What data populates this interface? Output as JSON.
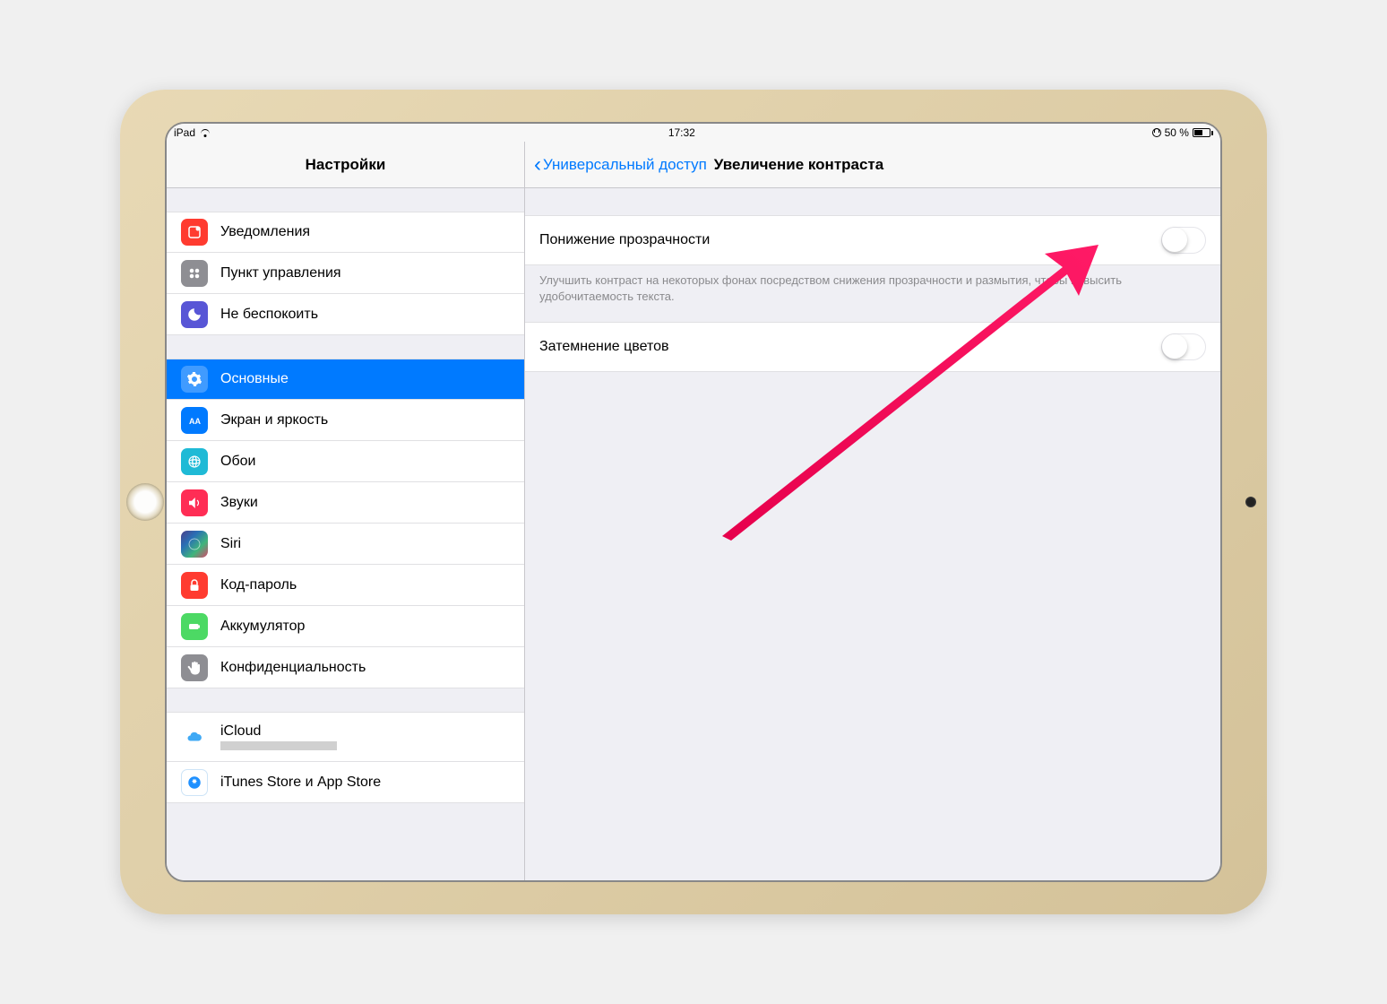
{
  "statusbar": {
    "device": "iPad",
    "time": "17:32",
    "battery_pct": "50 %"
  },
  "sidebar": {
    "title": "Настройки",
    "group1": [
      {
        "label": "Уведомления"
      },
      {
        "label": "Пункт управления"
      },
      {
        "label": "Не беспокоить"
      }
    ],
    "group2": [
      {
        "label": "Основные"
      },
      {
        "label": "Экран и яркость"
      },
      {
        "label": "Обои"
      },
      {
        "label": "Звуки"
      },
      {
        "label": "Siri"
      },
      {
        "label": "Код-пароль"
      },
      {
        "label": "Аккумулятор"
      },
      {
        "label": "Конфиденциальность"
      }
    ],
    "group3": [
      {
        "label": "iCloud"
      },
      {
        "label": "iTunes Store и App Store"
      }
    ]
  },
  "detail": {
    "back_label": "Универсальный доступ",
    "title": "Увеличение контраста",
    "rows": [
      {
        "label": "Понижение прозрачности",
        "footer": "Улучшить контраст на некоторых фонах посредством снижения прозрачности и размытия, чтобы повысить удобочитаемость текста."
      },
      {
        "label": "Затемнение цветов"
      }
    ]
  }
}
